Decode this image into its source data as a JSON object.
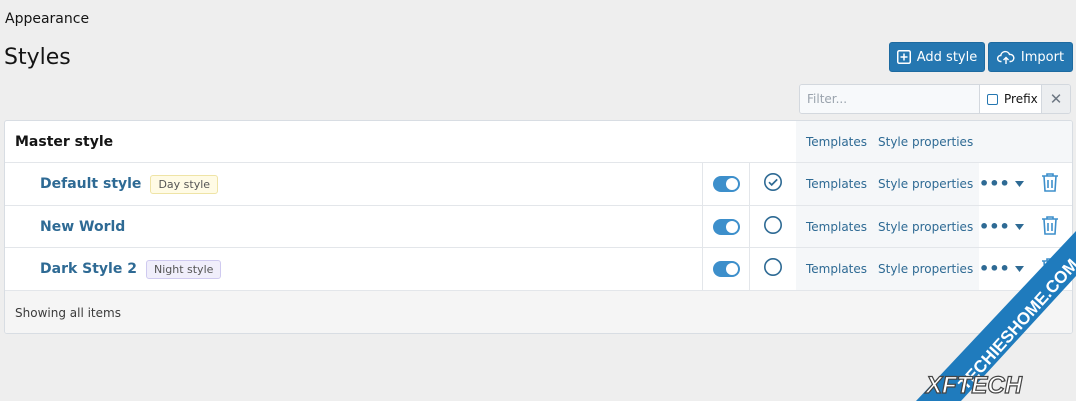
{
  "breadcrumb": "Appearance",
  "page_title": "Styles",
  "buttons": {
    "add_style": "Add style",
    "import": "Import"
  },
  "filter": {
    "placeholder": "Filter...",
    "value": "",
    "prefix_label": "Prefix",
    "clear_symbol": "✕"
  },
  "master": {
    "name": "Master style",
    "templates": "Templates",
    "style_properties": "Style properties"
  },
  "styles": [
    {
      "name": "Default style",
      "badge": "Day style",
      "enabled": true,
      "default": true,
      "templates": "Templates",
      "style_properties": "Style properties"
    },
    {
      "name": "New World",
      "badge": "",
      "enabled": true,
      "default": false,
      "templates": "Templates",
      "style_properties": "Style properties"
    },
    {
      "name": "Dark Style 2",
      "badge": "Night style",
      "enabled": true,
      "default": false,
      "templates": "Templates",
      "style_properties": "Style properties"
    }
  ],
  "footer": "Showing all items",
  "more_symbol": "•••",
  "watermark": {
    "line1": "TECHIESHOME.COM",
    "line2": "XFTECH"
  },
  "colors": {
    "primary": "#2577b1",
    "link": "#2e6a94",
    "toggle_on": "#3d8fcb",
    "page_bg": "#eeeeee",
    "badge_day": "#fffbe5",
    "badge_night": "#f0eefb",
    "watermark": "#1f7bbd"
  }
}
